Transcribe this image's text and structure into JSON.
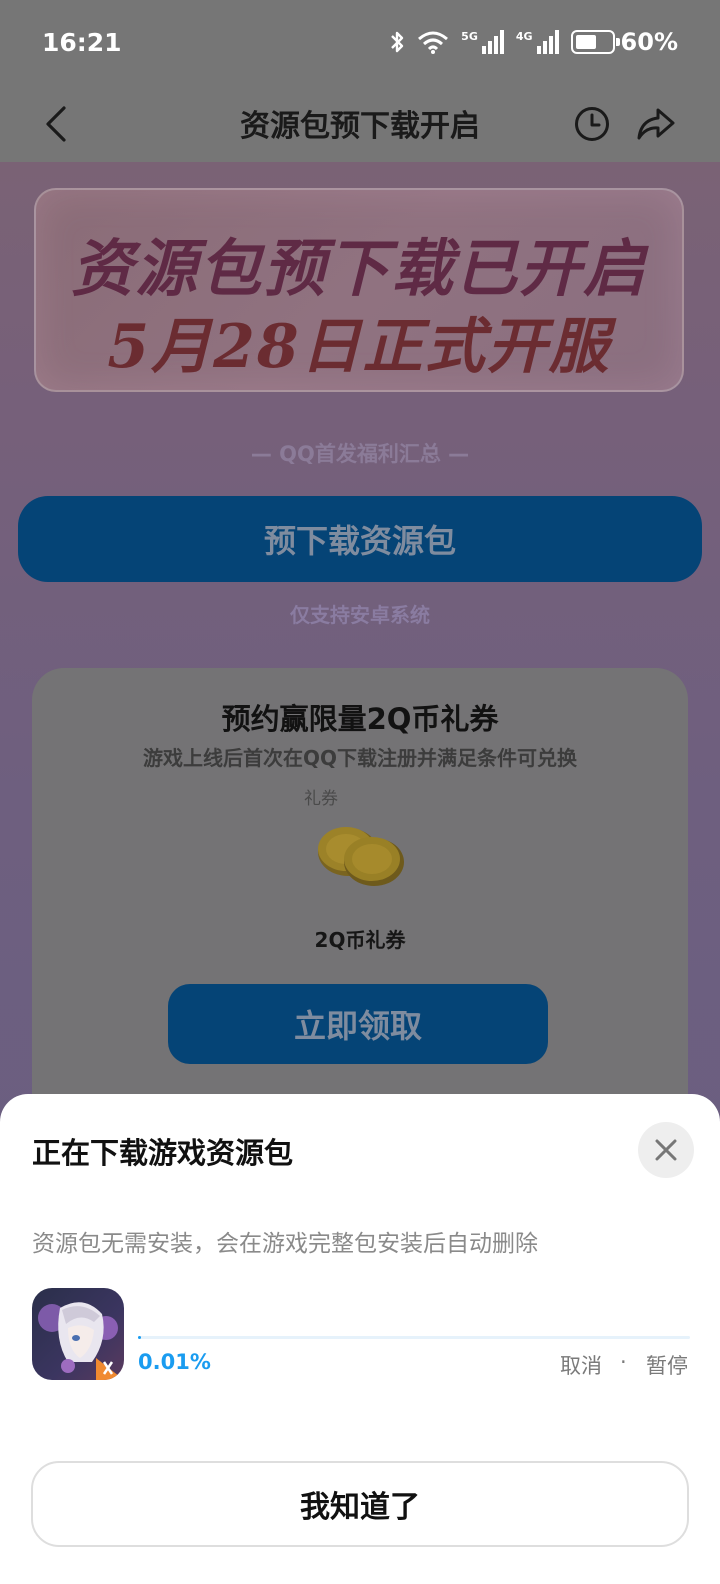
{
  "status_bar": {
    "time": "16:21",
    "network_5g": "5G",
    "network_4g": "4G",
    "battery_percent": "60%",
    "battery_level": 0.6,
    "icons": [
      "bluetooth-icon",
      "wifi-icon",
      "signal-5g-icon",
      "signal-4g-icon",
      "battery-icon"
    ]
  },
  "nav": {
    "title": "资源包预下载开启",
    "icons": [
      "back-icon",
      "history-clock-icon",
      "share-icon"
    ]
  },
  "page": {
    "banner_line1": "资源包预下载已开启",
    "banner_line2": "5月28日正式开服",
    "section_label": "— QQ首发福利汇总 —",
    "pre_download_button": "预下载资源包",
    "android_note": "仅支持安卓系统",
    "card": {
      "title": "预约赢限量2Q币礼券",
      "subtitle": "游戏上线后首次在QQ下载注册并满足条件可兑换",
      "tag": "礼券",
      "coupon_name": "2Q币礼券",
      "claim_button": "立即领取"
    }
  },
  "sheet": {
    "title": "正在下载游戏资源包",
    "description": "资源包无需安装，会在游戏完整包安装后自动删除",
    "progress_text": "0.01%",
    "progress_value": 0.0001,
    "cancel_label": "取消",
    "separator": "·",
    "pause_label": "暂停",
    "ok_button": "我知道了"
  },
  "colors": {
    "accent_blue": "#1a9cf0",
    "button_dark_blue": "#054476",
    "overlay_grey": "#767676"
  }
}
